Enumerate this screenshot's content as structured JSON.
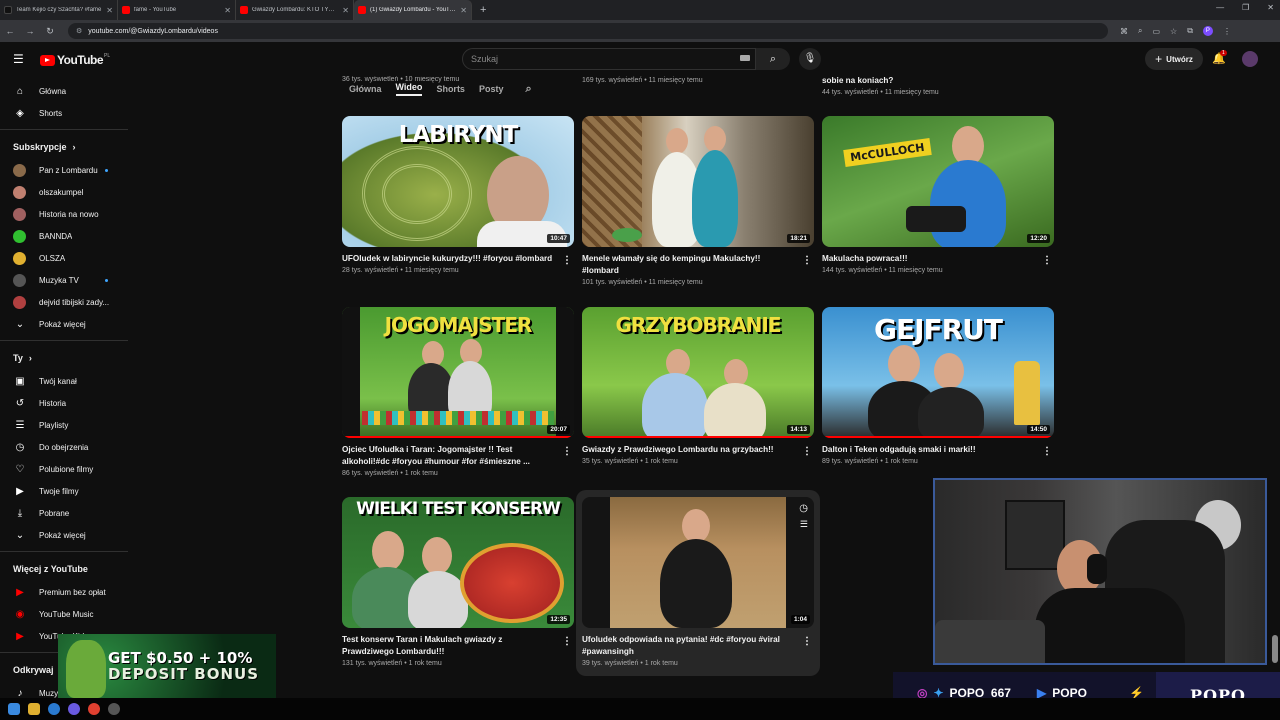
{
  "browser": {
    "tabs": [
      {
        "title": "Team Kejio czy Szachta? #fame",
        "color": "#111111"
      },
      {
        "title": "fame - YouTube",
        "color": "#ff0000"
      },
      {
        "title": "Gwiazdy Lombardu: KTO TYM R",
        "color": "#ff0000"
      },
      {
        "title": "(1) Gwiazdy Lombardu - YouTube",
        "color": "#ff0000"
      }
    ],
    "new_tab": "+",
    "url": "youtube.com/@GwiazdyLombardu/videos"
  },
  "header": {
    "logo_text": "YouTube",
    "country_code": "PL",
    "search_placeholder": "Szukaj",
    "create_label": "Utwórz",
    "notification_count": "1"
  },
  "sidebar": {
    "main": [
      {
        "label": "Główna",
        "icon": "⌂"
      },
      {
        "label": "Shorts",
        "icon": "◈"
      }
    ],
    "subs_title": "Subskrypcje",
    "subs": [
      {
        "label": "Pan z Lombardu",
        "color": "#8a6a4a",
        "live": true
      },
      {
        "label": "olszakumpel",
        "color": "#c08070",
        "live": false
      },
      {
        "label": "Historia na nowo",
        "color": "#a06060",
        "live": false
      },
      {
        "label": "BANNDA",
        "color": "#30c030",
        "live": false
      },
      {
        "label": "OLSZA",
        "color": "#e0b030",
        "live": false
      },
      {
        "label": "Muzyka TV",
        "color": "#555555",
        "live": true
      },
      {
        "label": "dejvid tibijski zady...",
        "color": "#b04040",
        "live": false
      }
    ],
    "subs_more": "Pokaż więcej",
    "you_title": "Ty",
    "you": [
      {
        "label": "Twój kanał",
        "icon": "▣"
      },
      {
        "label": "Historia",
        "icon": "↺"
      },
      {
        "label": "Playlisty",
        "icon": "☰"
      },
      {
        "label": "Do obejrzenia",
        "icon": "◷"
      },
      {
        "label": "Polubione filmy",
        "icon": "♡"
      },
      {
        "label": "Twoje filmy",
        "icon": "▶"
      },
      {
        "label": "Pobrane",
        "icon": "⤓"
      }
    ],
    "you_more": "Pokaż więcej",
    "more_title": "Więcej z YouTube",
    "more": [
      {
        "label": "Premium bez opłat"
      },
      {
        "label": "YouTube Music"
      },
      {
        "label": "YouTube Kids"
      }
    ],
    "explore_title": "Odkrywaj",
    "explore": [
      {
        "label": "Muzyka"
      }
    ]
  },
  "channel_tabs": [
    "Główna",
    "Wideo",
    "Shorts",
    "Posty"
  ],
  "top_row": [
    {
      "meta": "36 tys. wyświetleń • 10 miesięcy temu"
    },
    {
      "meta": "169 tys. wyświetleń • 11 miesięcy temu"
    },
    {
      "title": "sobie na koniach?",
      "meta": "44 tys. wyświetleń • 11 miesięcy temu"
    }
  ],
  "videos": [
    {
      "title": "UFOludek w labiryncie kukurydzy!!! #foryou #lombard",
      "meta": "28 tys. wyświetleń • 11 miesięcy temu",
      "duration": "10:47",
      "thumb_text": "LABIRYNT",
      "progress": 0
    },
    {
      "title": "Menele włamały się do kempingu Makulachy!! #lombard",
      "meta": "101 tys. wyświetleń • 11 miesięcy temu",
      "duration": "18:21",
      "thumb_text": "",
      "progress": 0
    },
    {
      "title": "Makulacha powraca!!!",
      "meta": "144 tys. wyświetleń • 11 miesięcy temu",
      "duration": "12:20",
      "thumb_text": "McCULLOCH",
      "progress": 0
    },
    {
      "title": "Ojciec Ufoludka i Taran: Jogomajster !! Test alkoholi!#dc #foryou #humour #for #śmieszne ...",
      "meta": "86 tys. wyświetleń • 1 rok temu",
      "duration": "20:07",
      "thumb_text": "JOGOMAJSTER",
      "progress": 1
    },
    {
      "title": "Gwiazdy z Prawdziwego Lombardu na grzybach!!",
      "meta": "35 tys. wyświetleń • 1 rok temu",
      "duration": "14:13",
      "thumb_text": "GRZYBOBRANIE",
      "progress": 1
    },
    {
      "title": "Dalton i Teken odgadują smaki i marki!!",
      "meta": "89 tys. wyświetleń • 1 rok temu",
      "duration": "14:50",
      "thumb_text": "GEJFRUT",
      "progress": 1
    },
    {
      "title": "Test konserw Taran i Makulach gwiazdy z Prawdziwego Lombardu!!!",
      "meta": "131 tys. wyświetleń • 1 rok temu",
      "duration": "12:35",
      "thumb_text": "WIELKI TEST KONSERW",
      "progress": 0
    },
    {
      "title": "Ufoludek odpowiada na pytania! #dc #foryou #viral #pawansingh",
      "meta": "39 tys. wyświetleń • 1 rok temu",
      "duration": "1:04",
      "thumb_text": "",
      "progress": 0
    }
  ],
  "overlay": {
    "handle1": "POPO_667",
    "handle2": "POPO",
    "brand": "POPO"
  },
  "ad": {
    "line1": "GET $0.50 + 10%",
    "line2": "DEPOSIT BONUS"
  }
}
